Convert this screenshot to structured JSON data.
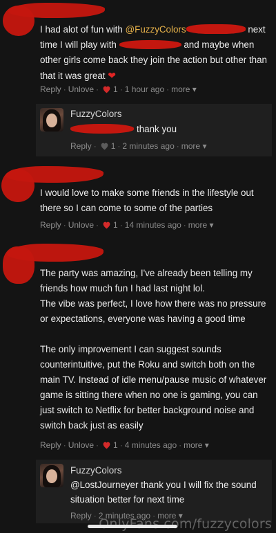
{
  "comments": [
    {
      "text_before": "I had alot of fun with ",
      "mention": "@FuzzyColors",
      "text_after": " next time I will play with ",
      "text_after2": " and maybe when other girls come back they join the action but other than that it was great",
      "emoji": "❤",
      "meta": {
        "reply": "Reply",
        "action": "Unlove",
        "likes": "1",
        "time": "1 hour ago",
        "more": "more ▾"
      },
      "reply": {
        "author": "FuzzyColors",
        "text": "thank you",
        "meta": {
          "reply": "Reply",
          "likes": "1",
          "time": "2 minutes ago",
          "more": "more ▾"
        }
      }
    },
    {
      "text": "I would love to make some friends in the lifestyle out there so I can come to some of the parties",
      "meta": {
        "reply": "Reply",
        "action": "Unlove",
        "likes": "1",
        "time": "14 minutes ago",
        "more": "more ▾"
      }
    },
    {
      "p1": "The party was amazing, I've already been telling my friends how much fun I had last night lol.",
      "p2": "The vibe was perfect, I love how there was no pressure or expectations, everyone was having a good time",
      "p3": "The only improvement I can suggest sounds counterintuitive, put the Roku and switch both on the main TV. Instead of idle menu/pause music of whatever game is sitting there when no one is gaming, you can just switch to Netflix for better background noise and switch back just as easily",
      "meta": {
        "reply": "Reply",
        "action": "Unlove",
        "likes": "1",
        "time": "4 minutes ago",
        "more": "more ▾"
      },
      "reply": {
        "author": "FuzzyColors",
        "text": "@LostJourneyer thank you I will fix the sound situation better for next time",
        "meta": {
          "reply": "Reply",
          "time": "2 minutes ago",
          "more": "more ▾"
        }
      }
    }
  ],
  "watermark": "OnlyFans.com/fuzzycolors",
  "colors": {
    "redaction": "#c4170f",
    "mention": "#e6b14a",
    "heart": "#d42a2a",
    "background": "#141414"
  }
}
